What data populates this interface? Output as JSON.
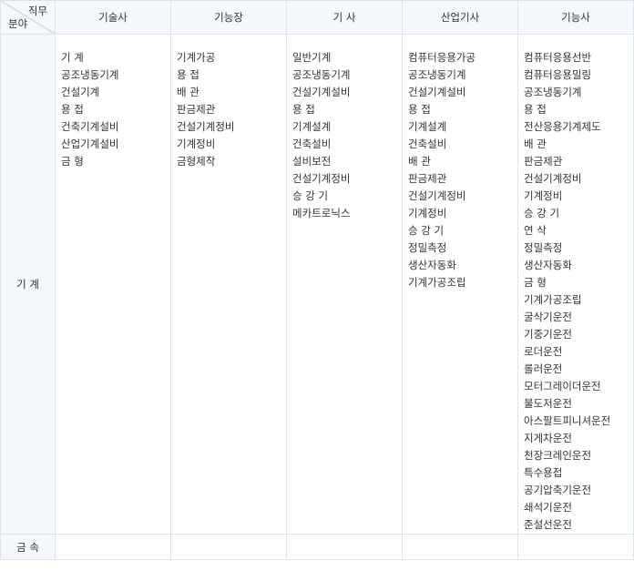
{
  "corner": {
    "top": "직무",
    "bottom": "분야"
  },
  "columns": [
    "기술사",
    "기능장",
    "기 사",
    "산업기사",
    "기능사"
  ],
  "rows": [
    {
      "label": "기 계",
      "cells": [
        [
          "기 계",
          "공조냉동기계",
          "건설기계",
          "용 접",
          "건축기계설비",
          "산업기계설비",
          "금 형"
        ],
        [
          "기계가공",
          "용 접",
          "배 관",
          "판금제관",
          "건설기계정비",
          "기계정비",
          "금형제작"
        ],
        [
          "일반기계",
          "공조냉동기계",
          "건설기계설비",
          "용 접",
          "기계설계",
          "건축설비",
          "설비보전",
          "건설기계정비",
          "승 강 기",
          "메카트로닉스"
        ],
        [
          "컴퓨터응용가공",
          "공조냉동기계",
          "건설기계설비",
          "용 접",
          "기계설계",
          "건축설비",
          "배 관",
          "판금제관",
          "건설기계정비",
          "기계정비",
          "승 강 기",
          "정밀측정",
          "생산자동화",
          "기계가공조립"
        ],
        [
          "컴퓨터응용선반",
          "컴퓨터응용밀링",
          "공조냉동기계",
          "용 접",
          "전산응용기계제도",
          "배 관",
          "판금제관",
          "건설기계정비",
          "기계정비",
          "승 강 기",
          "연 삭",
          "정밀측정",
          "생산자동화",
          "금 형",
          "기계가공조립",
          "굴삭기운전",
          "기중기운전",
          "로더운전",
          "롤러운전",
          "모터그레이더운전",
          "불도저운전",
          "아스팔트피니셔운전",
          "지게차운전",
          "천장크레인운전",
          "특수용접",
          "공기압축기운전",
          "쇄석기운전",
          "준설선운전"
        ]
      ]
    },
    {
      "label": "금 속",
      "cells": [
        [],
        [],
        [],
        [],
        []
      ]
    }
  ]
}
